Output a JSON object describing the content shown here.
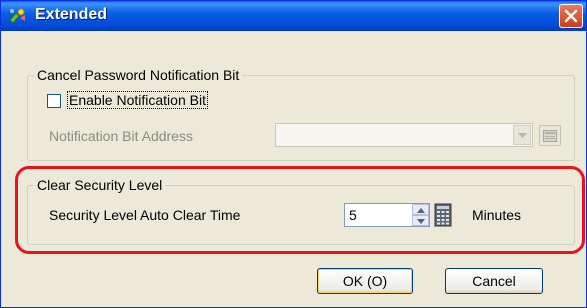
{
  "window": {
    "title": "Extended",
    "close_icon": "close-icon",
    "app_icon": "app-icon"
  },
  "group_notification": {
    "legend": "Cancel Password Notification Bit",
    "checkbox_label": "Enable Notification Bit",
    "checkbox_checked": false,
    "address_label": "Notification Bit Address",
    "address_value": "",
    "address_enabled": false
  },
  "group_security": {
    "legend": "Clear Security Level",
    "time_label": "Security Level Auto Clear Time",
    "time_value": "5",
    "unit_label": "Minutes"
  },
  "buttons": {
    "ok_label": "OK (O)",
    "cancel_label": "Cancel"
  },
  "colors": {
    "highlight": "#e8141d",
    "titlebar": "#0a5fe0",
    "dialog_bg": "#ece9d8"
  }
}
